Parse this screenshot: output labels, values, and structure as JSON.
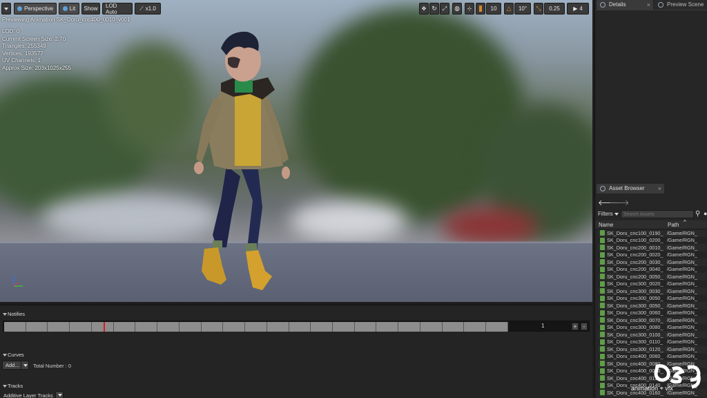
{
  "viewport": {
    "toolbar": {
      "perspective": "Perspective",
      "lit": "Lit",
      "show": "Show",
      "lod": "LOD Auto",
      "speed": "x1.0",
      "grid_snap": "10",
      "angle_snap": "10°",
      "scale_snap": "0.25",
      "camera_speed": "4"
    },
    "preview_label": "Previewing Animation SK_Doru_cnc400_0010_v001",
    "stats": [
      "LOD: 0",
      "Current Screen Size: 2.70",
      "Triangles: 255349",
      "Vertices: 193577",
      "UV Channels: 1",
      "Approx Size: 203x1025x255"
    ]
  },
  "tabs": {
    "details": "Details",
    "preview_scene": "Preview Scene",
    "asset_browser": "Asset Browser"
  },
  "asset_browser": {
    "filters": "Filters",
    "search_placeholder": "Search Assets",
    "col_name": "Name",
    "col_path": "Path",
    "rows": [
      {
        "name": "SK_Doru_cnc100_0190_",
        "path": "/Game/RGN_"
      },
      {
        "name": "SK_Doru_cnc100_0200_",
        "path": "/Game/RGN_"
      },
      {
        "name": "SK_Doru_cnc200_0010_",
        "path": "/Game/RGN_"
      },
      {
        "name": "SK_Doru_cnc200_0020_",
        "path": "/Game/RGN_"
      },
      {
        "name": "SK_Doru_cnc200_0030_",
        "path": "/Game/RGN_"
      },
      {
        "name": "SK_Doru_cnc200_0040_",
        "path": "/Game/RGN_"
      },
      {
        "name": "SK_Doru_cnc200_0050_",
        "path": "/Game/RGN_"
      },
      {
        "name": "SK_Doru_cnc300_0020_",
        "path": "/Game/RGN_"
      },
      {
        "name": "SK_Doru_cnc300_0030_",
        "path": "/Game/RGN_"
      },
      {
        "name": "SK_Doru_cnc300_0050_",
        "path": "/Game/RGN_"
      },
      {
        "name": "SK_Doru_cnc300_0050_",
        "path": "/Game/RGN_"
      },
      {
        "name": "SK_Doru_cnc300_0060_",
        "path": "/Game/RGN_"
      },
      {
        "name": "SK_Doru_cnc300_0070_",
        "path": "/Game/RGN_"
      },
      {
        "name": "SK_Doru_cnc300_0080_",
        "path": "/Game/RGN_"
      },
      {
        "name": "SK_Doru_cnc300_0100_",
        "path": "/Game/RGN_"
      },
      {
        "name": "SK_Doru_cnc300_0110_",
        "path": "/Game/RGN_"
      },
      {
        "name": "SK_Doru_cnc300_0120_",
        "path": "/Game/RGN_"
      },
      {
        "name": "SK_Doru_cnc400_0060_",
        "path": "/Game/RGN_"
      },
      {
        "name": "SK_Doru_cnc400_0080_",
        "path": "/Game/RGN_"
      },
      {
        "name": "SK_Doru_cnc400_0090_",
        "path": "/Game/RGN_"
      },
      {
        "name": "SK_Doru_cnc400_0110_",
        "path": "/Game/RGN_"
      },
      {
        "name": "SK_Doru_cnc400_0140_",
        "path": "/Game/RGN_"
      },
      {
        "name": "SK_Doru_cnc400_0160_",
        "path": "/Game/RGN_"
      }
    ]
  },
  "bottom": {
    "notifies": "Notifies",
    "frame": "1",
    "plus": "+",
    "minus": "-",
    "curves": "Curves",
    "add": "Add...",
    "total": "Total Number : 0",
    "tracks": "Tracks",
    "additive_layer_tracks": "Additive Layer Tracks"
  },
  "watermark": {
    "text": "animation + vfx"
  },
  "colors": {
    "accent_orange": "#d68a2a",
    "playhead": "#d02020",
    "asset_icon": "#5e9e4a"
  }
}
